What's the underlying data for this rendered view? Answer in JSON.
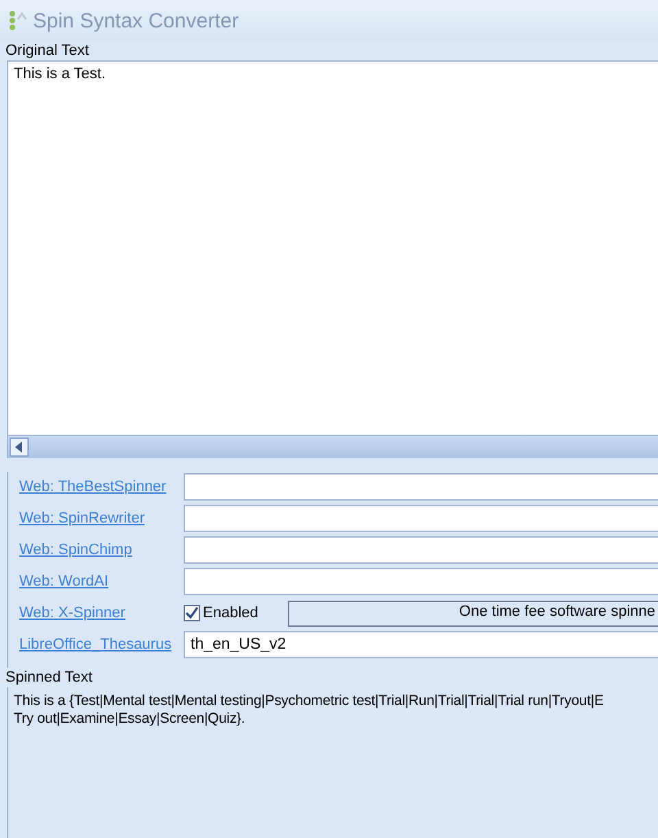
{
  "window": {
    "title": "Spin Syntax Converter"
  },
  "original": {
    "label": "Original Text",
    "value": "This is a Test."
  },
  "services": [
    {
      "kind": "field",
      "label": "Web: TheBestSpinner"
    },
    {
      "kind": "field",
      "label": "Web: SpinRewriter"
    },
    {
      "kind": "field",
      "label": "Web: SpinChimp"
    },
    {
      "kind": "field",
      "label": "Web: WordAI"
    },
    {
      "kind": "toggle",
      "label": "Web: X-Spinner",
      "checked": true,
      "checkbox_label": "Enabled",
      "info": "One time fee software spinne"
    },
    {
      "kind": "field",
      "label": "LibreOffice_Thesaurus",
      "value": "th_en_US_v2"
    }
  ],
  "spinned": {
    "label": "Spinned Text",
    "lines": [
      "This is a {Test|Mental test|Mental testing|Psychometric test|Trial|Run|Trial|Trial|Trial run|Tryout|E",
      "Try out|Examine|Essay|Screen|Quiz}."
    ]
  }
}
